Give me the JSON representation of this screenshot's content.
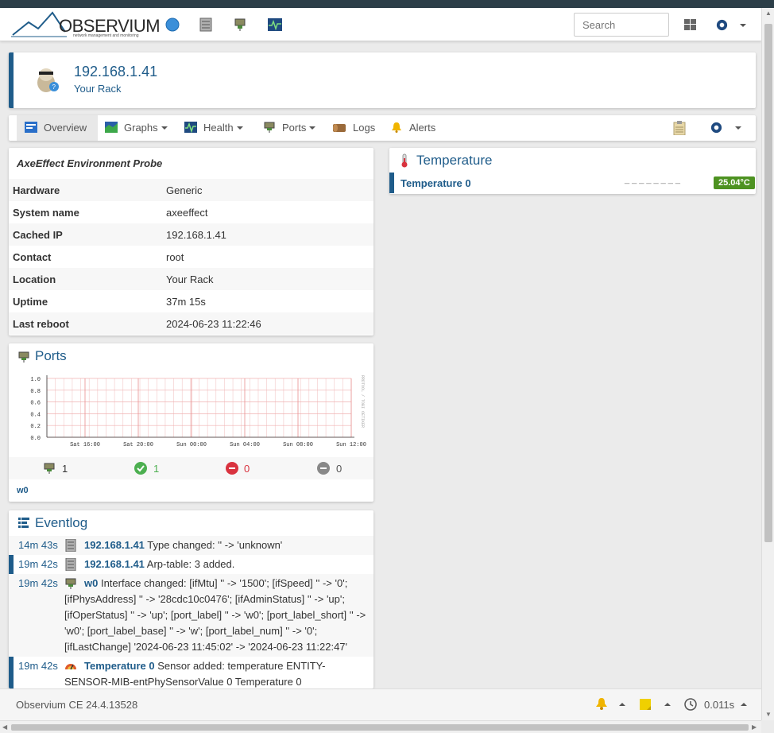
{
  "app": {
    "logo_text": "OBSERVIUM",
    "logo_tagline": "network management and monitoring",
    "search_placeholder": "Search"
  },
  "device": {
    "hostname": "192.168.1.41",
    "location": "Your Rack"
  },
  "tabs": [
    {
      "label": "Overview",
      "icon": "overview-icon",
      "has_caret": false
    },
    {
      "label": "Graphs",
      "icon": "graphs-icon",
      "has_caret": true
    },
    {
      "label": "Health",
      "icon": "health-icon",
      "has_caret": true
    },
    {
      "label": "Ports",
      "icon": "ports-icon",
      "has_caret": true
    },
    {
      "label": "Logs",
      "icon": "logs-icon",
      "has_caret": false
    },
    {
      "label": "Alerts",
      "icon": "alerts-icon",
      "has_caret": false
    }
  ],
  "overview": {
    "title": "AxeEffect Environment Probe",
    "rows": [
      {
        "key": "Hardware",
        "value": "Generic"
      },
      {
        "key": "System name",
        "value": "axeeffect"
      },
      {
        "key": "Cached IP",
        "value": "192.168.1.41"
      },
      {
        "key": "Contact",
        "value": "root"
      },
      {
        "key": "Location",
        "value": "Your Rack"
      },
      {
        "key": "Uptime",
        "value": "37m 15s"
      },
      {
        "key": "Last reboot",
        "value": "2024-06-23 11:22:46"
      }
    ]
  },
  "ports": {
    "title": "Ports",
    "graph_side_label": "RRDTOOL / TOBI OETIKER",
    "counts": {
      "total": "1",
      "up": "1",
      "down": "0",
      "disabled": "0"
    },
    "port_list": "w0"
  },
  "chart_data": {
    "type": "line",
    "title": "",
    "xlabel": "",
    "ylabel": "",
    "x_ticks": [
      "Sat 16:00",
      "Sat 20:00",
      "Sun 00:00",
      "Sun 04:00",
      "Sun 08:00",
      "Sun 12:00"
    ],
    "y_ticks": [
      "0.0",
      "0.2",
      "0.4",
      "0.6",
      "0.8",
      "1.0"
    ],
    "ylim": [
      0,
      1.0
    ],
    "grid": true,
    "series": []
  },
  "temperature": {
    "title": "Temperature",
    "sensor_name": "Temperature 0",
    "sparkline": "________",
    "value": "25.04°C",
    "value_color": "#4d9221"
  },
  "eventlog": {
    "title": "Eventlog",
    "events": [
      {
        "time": "14m 43s",
        "entity": "192.168.1.41",
        "message": " Type changed: '' -> 'unknown'"
      },
      {
        "time": "19m 42s",
        "entity": "192.168.1.41",
        "message": " Arp-table: 3 added."
      },
      {
        "time": "19m 42s",
        "entity": "w0",
        "message": " Interface changed: [ifMtu] '' -> '1500'; [ifSpeed] '' -> '0'; [ifPhysAddress] '' -> '28cdc10c0476'; [ifAdminStatus] '' -> 'up'; [ifOperStatus] '' -> 'up'; [port_label] '' -> 'w0'; [port_label_short] '' -> 'w0'; [port_label_base] '' -> 'w'; [port_label_num] '' -> '0'; [ifLastChange] '2024-06-23 11:45:02' -> '2024-06-23 11:22:47'"
      },
      {
        "time": "19m 42s",
        "entity": "Temperature 0",
        "message": " Sensor added: temperature ENTITY-SENSOR-MIB-entPhySensorValue 0 Temperature 0"
      }
    ]
  },
  "footer": {
    "version": "Observium CE 24.4.13528",
    "timer": "0.011s"
  },
  "colors": {
    "accent": "#1f5c8a",
    "ok": "#4caf50",
    "down": "#d9333f",
    "disabled": "#888888"
  }
}
